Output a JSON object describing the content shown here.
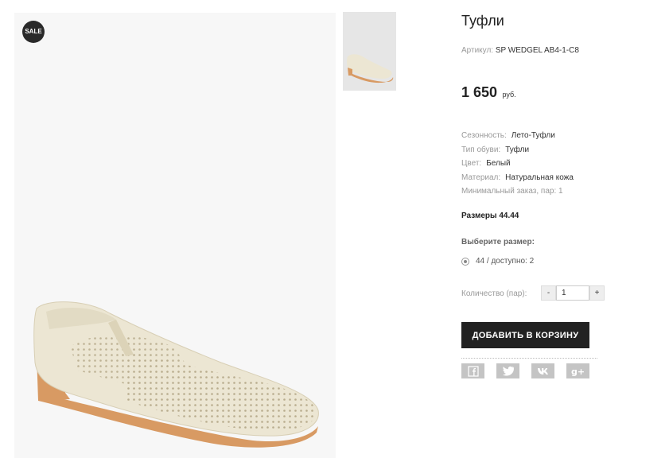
{
  "product": {
    "badge": "SALE",
    "title": "Туфли",
    "sku_label": "Артикул:",
    "sku_value": "SP WEDGEL AB4-1-C8",
    "price": "1 650",
    "currency": "руб.",
    "attributes": [
      {
        "label": "Сезонность:",
        "value": "Лето-Туфли"
      },
      {
        "label": "Тип обуви:",
        "value": "Туфли"
      },
      {
        "label": "Цвет:",
        "value": "Белый"
      },
      {
        "label": "Материал:",
        "value": "Натуральная кожа"
      }
    ],
    "min_order": "Минимальный заказ, пар: 1",
    "sizes_text": "Размеры 44.44",
    "choose_size_label": "Выберите размер:",
    "size_option": "44 / доступно: 2",
    "quantity_label": "Количество (пар):",
    "quantity_value": "1",
    "minus": "-",
    "plus": "+",
    "add_to_cart": "ДОБАВИТЬ В КОРЗИНУ"
  },
  "social": [
    "facebook-icon",
    "twitter-icon",
    "vk-icon",
    "google-plus-icon"
  ],
  "colors": {
    "button_bg": "#222222",
    "social_bg": "#c4c4c4",
    "shoe": "#ece6d3",
    "sole": "#d89a63"
  }
}
